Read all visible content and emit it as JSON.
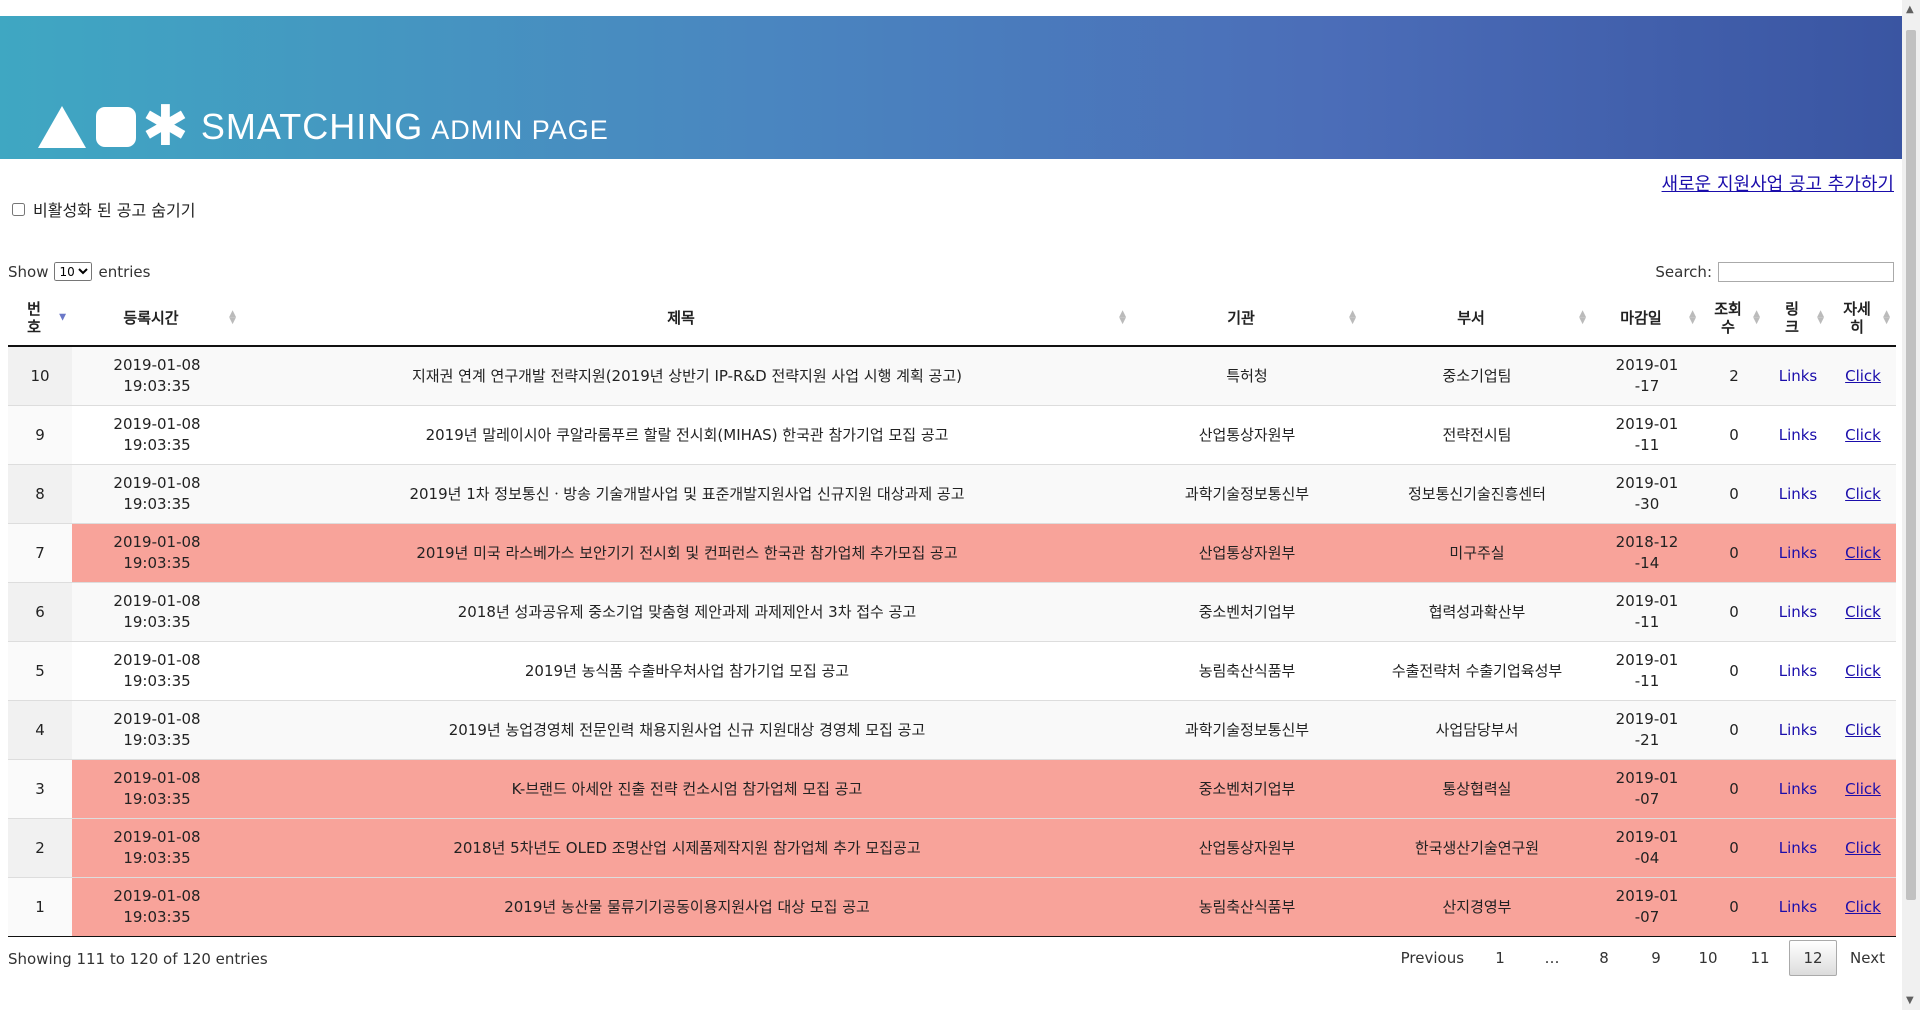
{
  "header": {
    "brand_main": "SMATCHING",
    "brand_sub": "ADMIN PAGE",
    "logo_star_icon": "star-icon"
  },
  "add_link": "새로운 지원사업 공고 추가하기",
  "hide_inactive": {
    "label": "비활성화 된 공고 숨기기",
    "checked": false
  },
  "length_menu": {
    "prefix": "Show",
    "selected": "10",
    "suffix": "entries"
  },
  "search": {
    "label": "Search:",
    "value": ""
  },
  "columns": [
    "번호",
    "등록시간",
    "제목",
    "기관",
    "부서",
    "마감일",
    "조회수",
    "링크",
    "자세히"
  ],
  "rows": [
    {
      "no": "10",
      "time": "2019-01-08 19:03:35",
      "title": "지재권 연계 연구개발 전략지원(2019년 상반기 IP-R&D 전략지원 사업 시행 계획 공고)",
      "org": "특허청",
      "dept": "중소기업팀",
      "deadline": "2019-01-17",
      "views": "2",
      "links": "Links",
      "detail": "Click",
      "highlight": false
    },
    {
      "no": "9",
      "time": "2019-01-08 19:03:35",
      "title": "2019년 말레이시아 쿠알라룸푸르 할랄 전시회(MIHAS) 한국관 참가기업 모집 공고",
      "org": "산업통상자원부",
      "dept": "전략전시팀",
      "deadline": "2019-01-11",
      "views": "0",
      "links": "Links",
      "detail": "Click",
      "highlight": false
    },
    {
      "no": "8",
      "time": "2019-01-08 19:03:35",
      "title": "2019년 1차 정보통신ㆍ방송 기술개발사업 및 표준개발지원사업 신규지원 대상과제 공고",
      "org": "과학기술정보통신부",
      "dept": "정보통신기술진흥센터",
      "deadline": "2019-01-30",
      "views": "0",
      "links": "Links",
      "detail": "Click",
      "highlight": false
    },
    {
      "no": "7",
      "time": "2019-01-08 19:03:35",
      "title": "2019년 미국 라스베가스 보안기기 전시회 및 컨퍼런스 한국관 참가업체 추가모집 공고",
      "org": "산업통상자원부",
      "dept": "미구주실",
      "deadline": "2018-12-14",
      "views": "0",
      "links": "Links",
      "detail": "Click",
      "highlight": true
    },
    {
      "no": "6",
      "time": "2019-01-08 19:03:35",
      "title": "2018년 성과공유제 중소기업 맞춤형 제안과제 과제제안서 3차 접수 공고",
      "org": "중소벤처기업부",
      "dept": "협력성과확산부",
      "deadline": "2019-01-11",
      "views": "0",
      "links": "Links",
      "detail": "Click",
      "highlight": false
    },
    {
      "no": "5",
      "time": "2019-01-08 19:03:35",
      "title": "2019년 농식품 수출바우처사업 참가기업 모집 공고",
      "org": "농림축산식품부",
      "dept": "수출전략처 수출기업육성부",
      "deadline": "2019-01-11",
      "views": "0",
      "links": "Links",
      "detail": "Click",
      "highlight": false
    },
    {
      "no": "4",
      "time": "2019-01-08 19:03:35",
      "title": "2019년 농업경영체 전문인력 채용지원사업 신규 지원대상 경영체 모집 공고",
      "org": "과학기술정보통신부",
      "dept": "사업담당부서",
      "deadline": "2019-01-21",
      "views": "0",
      "links": "Links",
      "detail": "Click",
      "highlight": false
    },
    {
      "no": "3",
      "time": "2019-01-08 19:03:35",
      "title": "K-브랜드 아세안 진출 전략 컨소시엄 참가업체 모집 공고",
      "org": "중소벤처기업부",
      "dept": "통상협력실",
      "deadline": "2019-01-07",
      "views": "0",
      "links": "Links",
      "detail": "Click",
      "highlight": true
    },
    {
      "no": "2",
      "time": "2019-01-08 19:03:35",
      "title": "2018년 5차년도 OLED 조명산업 시제품제작지원 참가업체 추가 모집공고",
      "org": "산업통상자원부",
      "dept": "한국생산기술연구원",
      "deadline": "2019-01-04",
      "views": "0",
      "links": "Links",
      "detail": "Click",
      "highlight": true
    },
    {
      "no": "1",
      "time": "2019-01-08 19:03:35",
      "title": "2019년 농산물 물류기기공동이용지원사업 대상 모집 공고",
      "org": "농림축산식품부",
      "dept": "산지경영부",
      "deadline": "2019-01-07",
      "views": "0",
      "links": "Links",
      "detail": "Click",
      "highlight": true
    }
  ],
  "info": "Showing 111 to 120 of 120 entries",
  "pagination": {
    "previous": "Previous",
    "pages": [
      "1",
      "…",
      "8",
      "9",
      "10",
      "11",
      "12"
    ],
    "current": "12",
    "next": "Next"
  },
  "colors": {
    "highlight_row": "#f8a39a",
    "link": "#1a0dab",
    "header_start": "#3fa7c2",
    "header_end": "#3a55a2"
  }
}
